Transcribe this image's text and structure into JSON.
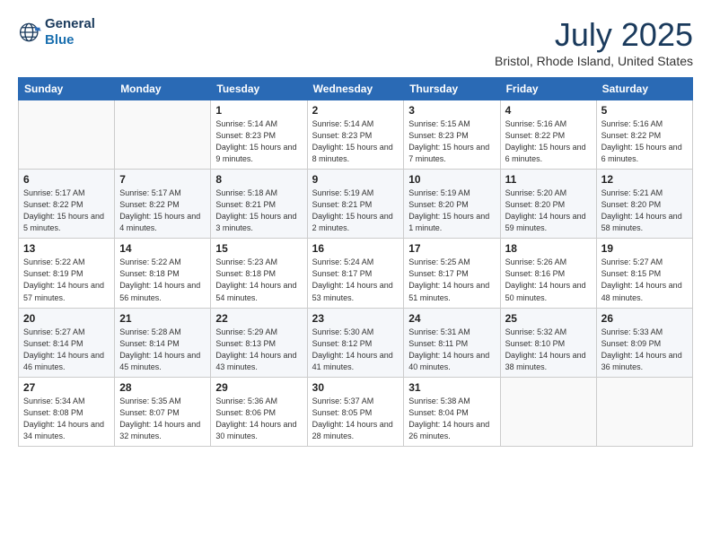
{
  "logo": {
    "line1": "General",
    "line2": "Blue"
  },
  "title": "July 2025",
  "subtitle": "Bristol, Rhode Island, United States",
  "weekdays": [
    "Sunday",
    "Monday",
    "Tuesday",
    "Wednesday",
    "Thursday",
    "Friday",
    "Saturday"
  ],
  "weeks": [
    [
      {
        "day": "",
        "sunrise": "",
        "sunset": "",
        "daylight": ""
      },
      {
        "day": "",
        "sunrise": "",
        "sunset": "",
        "daylight": ""
      },
      {
        "day": "1",
        "sunrise": "Sunrise: 5:14 AM",
        "sunset": "Sunset: 8:23 PM",
        "daylight": "Daylight: 15 hours and 9 minutes."
      },
      {
        "day": "2",
        "sunrise": "Sunrise: 5:14 AM",
        "sunset": "Sunset: 8:23 PM",
        "daylight": "Daylight: 15 hours and 8 minutes."
      },
      {
        "day": "3",
        "sunrise": "Sunrise: 5:15 AM",
        "sunset": "Sunset: 8:23 PM",
        "daylight": "Daylight: 15 hours and 7 minutes."
      },
      {
        "day": "4",
        "sunrise": "Sunrise: 5:16 AM",
        "sunset": "Sunset: 8:22 PM",
        "daylight": "Daylight: 15 hours and 6 minutes."
      },
      {
        "day": "5",
        "sunrise": "Sunrise: 5:16 AM",
        "sunset": "Sunset: 8:22 PM",
        "daylight": "Daylight: 15 hours and 6 minutes."
      }
    ],
    [
      {
        "day": "6",
        "sunrise": "Sunrise: 5:17 AM",
        "sunset": "Sunset: 8:22 PM",
        "daylight": "Daylight: 15 hours and 5 minutes."
      },
      {
        "day": "7",
        "sunrise": "Sunrise: 5:17 AM",
        "sunset": "Sunset: 8:22 PM",
        "daylight": "Daylight: 15 hours and 4 minutes."
      },
      {
        "day": "8",
        "sunrise": "Sunrise: 5:18 AM",
        "sunset": "Sunset: 8:21 PM",
        "daylight": "Daylight: 15 hours and 3 minutes."
      },
      {
        "day": "9",
        "sunrise": "Sunrise: 5:19 AM",
        "sunset": "Sunset: 8:21 PM",
        "daylight": "Daylight: 15 hours and 2 minutes."
      },
      {
        "day": "10",
        "sunrise": "Sunrise: 5:19 AM",
        "sunset": "Sunset: 8:20 PM",
        "daylight": "Daylight: 15 hours and 1 minute."
      },
      {
        "day": "11",
        "sunrise": "Sunrise: 5:20 AM",
        "sunset": "Sunset: 8:20 PM",
        "daylight": "Daylight: 14 hours and 59 minutes."
      },
      {
        "day": "12",
        "sunrise": "Sunrise: 5:21 AM",
        "sunset": "Sunset: 8:20 PM",
        "daylight": "Daylight: 14 hours and 58 minutes."
      }
    ],
    [
      {
        "day": "13",
        "sunrise": "Sunrise: 5:22 AM",
        "sunset": "Sunset: 8:19 PM",
        "daylight": "Daylight: 14 hours and 57 minutes."
      },
      {
        "day": "14",
        "sunrise": "Sunrise: 5:22 AM",
        "sunset": "Sunset: 8:18 PM",
        "daylight": "Daylight: 14 hours and 56 minutes."
      },
      {
        "day": "15",
        "sunrise": "Sunrise: 5:23 AM",
        "sunset": "Sunset: 8:18 PM",
        "daylight": "Daylight: 14 hours and 54 minutes."
      },
      {
        "day": "16",
        "sunrise": "Sunrise: 5:24 AM",
        "sunset": "Sunset: 8:17 PM",
        "daylight": "Daylight: 14 hours and 53 minutes."
      },
      {
        "day": "17",
        "sunrise": "Sunrise: 5:25 AM",
        "sunset": "Sunset: 8:17 PM",
        "daylight": "Daylight: 14 hours and 51 minutes."
      },
      {
        "day": "18",
        "sunrise": "Sunrise: 5:26 AM",
        "sunset": "Sunset: 8:16 PM",
        "daylight": "Daylight: 14 hours and 50 minutes."
      },
      {
        "day": "19",
        "sunrise": "Sunrise: 5:27 AM",
        "sunset": "Sunset: 8:15 PM",
        "daylight": "Daylight: 14 hours and 48 minutes."
      }
    ],
    [
      {
        "day": "20",
        "sunrise": "Sunrise: 5:27 AM",
        "sunset": "Sunset: 8:14 PM",
        "daylight": "Daylight: 14 hours and 46 minutes."
      },
      {
        "day": "21",
        "sunrise": "Sunrise: 5:28 AM",
        "sunset": "Sunset: 8:14 PM",
        "daylight": "Daylight: 14 hours and 45 minutes."
      },
      {
        "day": "22",
        "sunrise": "Sunrise: 5:29 AM",
        "sunset": "Sunset: 8:13 PM",
        "daylight": "Daylight: 14 hours and 43 minutes."
      },
      {
        "day": "23",
        "sunrise": "Sunrise: 5:30 AM",
        "sunset": "Sunset: 8:12 PM",
        "daylight": "Daylight: 14 hours and 41 minutes."
      },
      {
        "day": "24",
        "sunrise": "Sunrise: 5:31 AM",
        "sunset": "Sunset: 8:11 PM",
        "daylight": "Daylight: 14 hours and 40 minutes."
      },
      {
        "day": "25",
        "sunrise": "Sunrise: 5:32 AM",
        "sunset": "Sunset: 8:10 PM",
        "daylight": "Daylight: 14 hours and 38 minutes."
      },
      {
        "day": "26",
        "sunrise": "Sunrise: 5:33 AM",
        "sunset": "Sunset: 8:09 PM",
        "daylight": "Daylight: 14 hours and 36 minutes."
      }
    ],
    [
      {
        "day": "27",
        "sunrise": "Sunrise: 5:34 AM",
        "sunset": "Sunset: 8:08 PM",
        "daylight": "Daylight: 14 hours and 34 minutes."
      },
      {
        "day": "28",
        "sunrise": "Sunrise: 5:35 AM",
        "sunset": "Sunset: 8:07 PM",
        "daylight": "Daylight: 14 hours and 32 minutes."
      },
      {
        "day": "29",
        "sunrise": "Sunrise: 5:36 AM",
        "sunset": "Sunset: 8:06 PM",
        "daylight": "Daylight: 14 hours and 30 minutes."
      },
      {
        "day": "30",
        "sunrise": "Sunrise: 5:37 AM",
        "sunset": "Sunset: 8:05 PM",
        "daylight": "Daylight: 14 hours and 28 minutes."
      },
      {
        "day": "31",
        "sunrise": "Sunrise: 5:38 AM",
        "sunset": "Sunset: 8:04 PM",
        "daylight": "Daylight: 14 hours and 26 minutes."
      },
      {
        "day": "",
        "sunrise": "",
        "sunset": "",
        "daylight": ""
      },
      {
        "day": "",
        "sunrise": "",
        "sunset": "",
        "daylight": ""
      }
    ]
  ]
}
